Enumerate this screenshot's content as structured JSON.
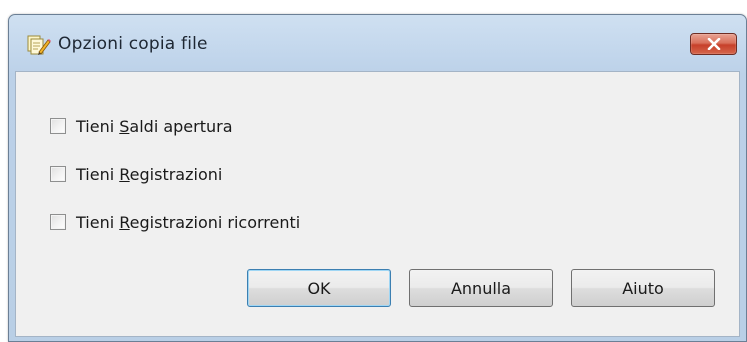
{
  "window": {
    "title": "Opzioni copia file"
  },
  "options": [
    {
      "prefix": "Tieni ",
      "mnemonic": "S",
      "suffix": "aldi apertura",
      "checked": false
    },
    {
      "prefix": "Tieni ",
      "mnemonic": "R",
      "suffix": "egistrazioni",
      "checked": false
    },
    {
      "prefix": "Tieni ",
      "mnemonic": "R",
      "suffix": "egistrazioni ricorrenti",
      "checked": false
    }
  ],
  "buttons": {
    "ok": "OK",
    "cancel": "Annulla",
    "help": "Aiuto"
  },
  "icons": {
    "app": "document-pencil-icon",
    "close": "close-icon"
  },
  "colors": {
    "close_button": "#c7402a",
    "title_bar": "#c2d6ec",
    "client_background": "#f0f0f0",
    "default_button_border": "#3c7fb1"
  }
}
